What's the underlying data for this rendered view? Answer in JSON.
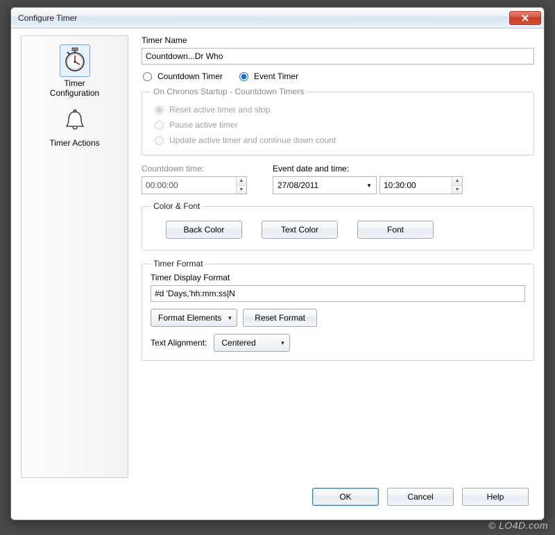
{
  "window": {
    "title": "Configure Timer"
  },
  "sidebar": {
    "items": [
      {
        "label": "Timer\nConfiguration",
        "icon": "stopwatch-icon"
      },
      {
        "label": "Timer Actions",
        "icon": "bell-icon"
      }
    ]
  },
  "main": {
    "timer_name_label": "Timer Name",
    "timer_name_value": "Countdown...Dr Who",
    "radio_countdown": "Countdown Timer",
    "radio_event": "Event Timer",
    "startup_group": {
      "legend": "On Chronos Startup - Countdown Timers",
      "opt_reset": "Reset active timer and stop",
      "opt_pause": "Pause active timer",
      "opt_update": "Update active timer and continue down count"
    },
    "countdown_time_label": "Countdown time:",
    "countdown_time_value": "00:00:00",
    "event_dt_label": "Event date and time:",
    "event_date_value": "27/08/2011",
    "event_time_value": "10:30:00",
    "colorfont": {
      "legend": "Color & Font",
      "back": "Back Color",
      "text": "Text Color",
      "font": "Font"
    },
    "timer_format": {
      "legend": "Timer Format",
      "display_label": "Timer Display Format",
      "display_value": "#d 'Days,'hh:mm:ss|N",
      "format_elements": "Format Elements",
      "reset_format": "Reset Format",
      "text_alignment_label": "Text Alignment:",
      "text_alignment_value": "Centered"
    }
  },
  "footer": {
    "ok": "OK",
    "cancel": "Cancel",
    "help": "Help"
  },
  "watermark": "© LO4D.com"
}
